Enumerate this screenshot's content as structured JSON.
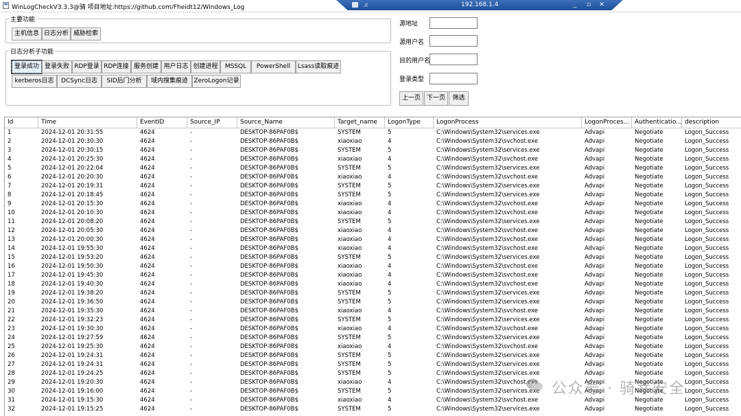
{
  "window": {
    "title": "WinLogCheckV3.3.3@骑 项目地址:https://github.com/Fheidt12/Windows_Log"
  },
  "rdp_bar": {
    "ip": "192.168.1.4",
    "minimize": "_",
    "restore": "▫",
    "close": "✕"
  },
  "main_group": {
    "label": "主要功能",
    "buttons": [
      "主机信息",
      "日志分析",
      "威胁检索"
    ]
  },
  "sub_group": {
    "label": "日志分析子功能",
    "row1": [
      "登录成功",
      "登录失败",
      "RDP登录",
      "RDP连接",
      "服务创建",
      "用户日志",
      "创建进程",
      "MSSQL",
      "PowerShell",
      "Lsass读取痕迹"
    ],
    "row2": [
      "kerberos日志",
      "DCSync日志",
      "SID后门分析",
      "域内搜集痕迹",
      "ZeroLogon记录"
    ]
  },
  "filters": {
    "source_addr": {
      "label": "源地址",
      "value": ""
    },
    "source_user": {
      "label": "源用户名",
      "value": ""
    },
    "target_user": {
      "label": "目的用户名",
      "value": ""
    },
    "logon_type": {
      "label": "登录类型",
      "value": ""
    },
    "prev_page": "上一页",
    "next_page": "下一页",
    "filter": "筛选"
  },
  "table": {
    "columns": [
      "Id",
      "Time",
      "EventID",
      "Source_IP",
      "Source_Name",
      "Target_name",
      "LogonType",
      "LogonProcess",
      "LogonProces...",
      "Authenticatio...",
      "description"
    ],
    "rows": [
      [
        "1",
        "2024-12-01 20:31:55",
        "4624",
        "-",
        "DESKTOP-86PAF0B$",
        "SYSTEM",
        "5",
        "C:\\Windows\\System32\\services.exe",
        "Advapi",
        "Negotiate",
        "Logon_Success"
      ],
      [
        "2",
        "2024-12-01 20:30:30",
        "4624",
        "-",
        "DESKTOP-86PAF0B$",
        "xiaoxiao",
        "4",
        "C:\\Windows\\System32\\svchost.exe",
        "Advapi",
        "Negotiate",
        "Logon_Success"
      ],
      [
        "3",
        "2024-12-01 20:30:15",
        "4624",
        "-",
        "DESKTOP-86PAF0B$",
        "SYSTEM",
        "5",
        "C:\\Windows\\System32\\services.exe",
        "Advapi",
        "Negotiate",
        "Logon_Success"
      ],
      [
        "4",
        "2024-12-01 20:25:30",
        "4624",
        "-",
        "DESKTOP-86PAF0B$",
        "xiaoxiao",
        "4",
        "C:\\Windows\\System32\\svchost.exe",
        "Advapi",
        "Negotiate",
        "Logon_Success"
      ],
      [
        "5",
        "2024-12-01 20:22:04",
        "4624",
        "-",
        "DESKTOP-86PAF0B$",
        "SYSTEM",
        "5",
        "C:\\Windows\\System32\\services.exe",
        "Advapi",
        "Negotiate",
        "Logon_Success"
      ],
      [
        "6",
        "2024-12-01 20:20:30",
        "4624",
        "-",
        "DESKTOP-86PAF0B$",
        "xiaoxiao",
        "4",
        "C:\\Windows\\System32\\svchost.exe",
        "Advapi",
        "Negotiate",
        "Logon_Success"
      ],
      [
        "7",
        "2024-12-01 20:19:31",
        "4624",
        "-",
        "DESKTOP-86PAF0B$",
        "SYSTEM",
        "5",
        "C:\\Windows\\System32\\services.exe",
        "Advapi",
        "Negotiate",
        "Logon_Success"
      ],
      [
        "8",
        "2024-12-01 20:18:45",
        "4624",
        "-",
        "DESKTOP-86PAF0B$",
        "SYSTEM",
        "5",
        "C:\\Windows\\System32\\services.exe",
        "Advapi",
        "Negotiate",
        "Logon_Success"
      ],
      [
        "9",
        "2024-12-01 20:15:30",
        "4624",
        "-",
        "DESKTOP-86PAF0B$",
        "xiaoxiao",
        "4",
        "C:\\Windows\\System32\\svchost.exe",
        "Advapi",
        "Negotiate",
        "Logon_Success"
      ],
      [
        "10",
        "2024-12-01 20:10:30",
        "4624",
        "-",
        "DESKTOP-86PAF0B$",
        "xiaoxiao",
        "4",
        "C:\\Windows\\System32\\svchost.exe",
        "Advapi",
        "Negotiate",
        "Logon_Success"
      ],
      [
        "11",
        "2024-12-01 20:08:20",
        "4624",
        "-",
        "DESKTOP-86PAF0B$",
        "SYSTEM",
        "5",
        "C:\\Windows\\System32\\services.exe",
        "Advapi",
        "Negotiate",
        "Logon_Success"
      ],
      [
        "12",
        "2024-12-01 20:05:30",
        "4624",
        "-",
        "DESKTOP-86PAF0B$",
        "xiaoxiao",
        "4",
        "C:\\Windows\\System32\\svchost.exe",
        "Advapi",
        "Negotiate",
        "Logon_Success"
      ],
      [
        "13",
        "2024-12-01 20:00:30",
        "4624",
        "-",
        "DESKTOP-86PAF0B$",
        "xiaoxiao",
        "4",
        "C:\\Windows\\System32\\svchost.exe",
        "Advapi",
        "Negotiate",
        "Logon_Success"
      ],
      [
        "14",
        "2024-12-01 19:55:30",
        "4624",
        "-",
        "DESKTOP-86PAF0B$",
        "xiaoxiao",
        "4",
        "C:\\Windows\\System32\\svchost.exe",
        "Advapi",
        "Negotiate",
        "Logon_Success"
      ],
      [
        "15",
        "2024-12-01 19:53:20",
        "4624",
        "-",
        "DESKTOP-86PAF0B$",
        "SYSTEM",
        "5",
        "C:\\Windows\\System32\\services.exe",
        "Advapi",
        "Negotiate",
        "Logon_Success"
      ],
      [
        "16",
        "2024-12-01 19:50:30",
        "4624",
        "-",
        "DESKTOP-86PAF0B$",
        "xiaoxiao",
        "4",
        "C:\\Windows\\System32\\svchost.exe",
        "Advapi",
        "Negotiate",
        "Logon_Success"
      ],
      [
        "17",
        "2024-12-01 19:45:30",
        "4624",
        "-",
        "DESKTOP-86PAF0B$",
        "xiaoxiao",
        "4",
        "C:\\Windows\\System32\\svchost.exe",
        "Advapi",
        "Negotiate",
        "Logon_Success"
      ],
      [
        "18",
        "2024-12-01 19:40:30",
        "4624",
        "-",
        "DESKTOP-86PAF0B$",
        "xiaoxiao",
        "4",
        "C:\\Windows\\System32\\svchost.exe",
        "Advapi",
        "Negotiate",
        "Logon_Success"
      ],
      [
        "19",
        "2024-12-01 19:38:20",
        "4624",
        "-",
        "DESKTOP-86PAF0B$",
        "SYSTEM",
        "5",
        "C:\\Windows\\System32\\services.exe",
        "Advapi",
        "Negotiate",
        "Logon_Success"
      ],
      [
        "20",
        "2024-12-01 19:36:50",
        "4624",
        "-",
        "DESKTOP-86PAF0B$",
        "SYSTEM",
        "5",
        "C:\\Windows\\System32\\services.exe",
        "Advapi",
        "Negotiate",
        "Logon_Success"
      ],
      [
        "21",
        "2024-12-01 19:35:30",
        "4624",
        "-",
        "DESKTOP-86PAF0B$",
        "xiaoxiao",
        "4",
        "C:\\Windows\\System32\\svchost.exe",
        "Advapi",
        "Negotiate",
        "Logon_Success"
      ],
      [
        "22",
        "2024-12-01 19:32:23",
        "4624",
        "-",
        "DESKTOP-86PAF0B$",
        "SYSTEM",
        "5",
        "C:\\Windows\\System32\\services.exe",
        "Advapi",
        "Negotiate",
        "Logon_Success"
      ],
      [
        "23",
        "2024-12-01 19:30:30",
        "4624",
        "-",
        "DESKTOP-86PAF0B$",
        "xiaoxiao",
        "4",
        "C:\\Windows\\System32\\svchost.exe",
        "Advapi",
        "Negotiate",
        "Logon_Success"
      ],
      [
        "24",
        "2024-12-01 19:27:59",
        "4624",
        "-",
        "DESKTOP-86PAF0B$",
        "SYSTEM",
        "5",
        "C:\\Windows\\System32\\services.exe",
        "Advapi",
        "Negotiate",
        "Logon_Success"
      ],
      [
        "25",
        "2024-12-01 19:25:30",
        "4624",
        "-",
        "DESKTOP-86PAF0B$",
        "xiaoxiao",
        "4",
        "C:\\Windows\\System32\\svchost.exe",
        "Advapi",
        "Negotiate",
        "Logon_Success"
      ],
      [
        "26",
        "2024-12-01 19:24:31",
        "4624",
        "-",
        "DESKTOP-86PAF0B$",
        "SYSTEM",
        "5",
        "C:\\Windows\\System32\\services.exe",
        "Advapi",
        "Negotiate",
        "Logon_Success"
      ],
      [
        "27",
        "2024-12-01 19:24:31",
        "4624",
        "-",
        "DESKTOP-86PAF0B$",
        "SYSTEM",
        "5",
        "C:\\Windows\\System32\\services.exe",
        "Advapi",
        "Negotiate",
        "Logon_Success"
      ],
      [
        "28",
        "2024-12-01 19:24:25",
        "4624",
        "-",
        "DESKTOP-86PAF0B$",
        "SYSTEM",
        "5",
        "C:\\Windows\\System32\\services.exe",
        "Advapi",
        "Negotiate",
        "Logon_Success"
      ],
      [
        "29",
        "2024-12-01 19:20:30",
        "4624",
        "-",
        "DESKTOP-86PAF0B$",
        "xiaoxiao",
        "4",
        "C:\\Windows\\System32\\svchost.exe",
        "Advapi",
        "Negotiate",
        "Logon_Success"
      ],
      [
        "30",
        "2024-12-01 19:16:00",
        "4624",
        "-",
        "DESKTOP-86PAF0B$",
        "SYSTEM",
        "5",
        "C:\\Windows\\System32\\services.exe",
        "Advapi",
        "Negotiate",
        "Logon_Success"
      ],
      [
        "31",
        "2024-12-01 19:15:30",
        "4624",
        "-",
        "DESKTOP-86PAF0B$",
        "xiaoxiao",
        "4",
        "C:\\Windows\\System32\\svchost.exe",
        "Advapi",
        "Negotiate",
        "Logon_Success"
      ],
      [
        "32",
        "2024-12-01 19:15:25",
        "4624",
        "-",
        "DESKTOP-86PAF0B$",
        "SYSTEM",
        "5",
        "C:\\Windows\\System32\\services.exe",
        "Advapi",
        "Negotiate",
        "Logon_Success"
      ]
    ]
  },
  "watermark": {
    "text": "公众号 · 骑莘安全"
  },
  "colors": {
    "rdp_bar": "#2a5ca8",
    "selected_button": "#e5f1fb"
  }
}
